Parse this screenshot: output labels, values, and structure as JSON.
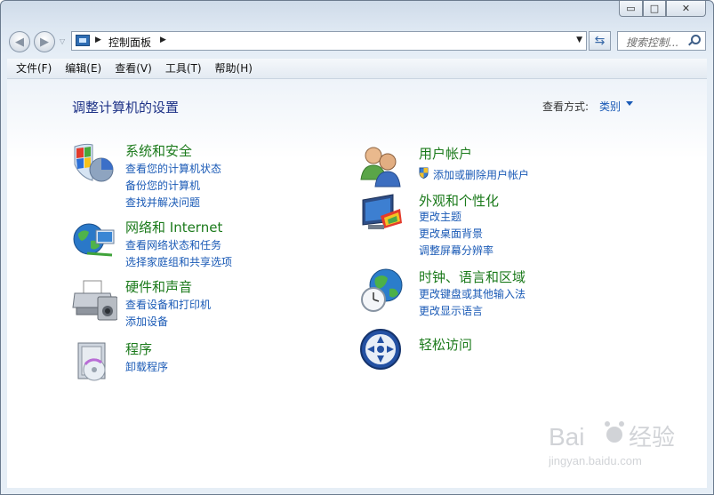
{
  "window": {
    "minimize": "▭",
    "maximize": "□",
    "close": "✕"
  },
  "address": {
    "breadcrumb": "控制面板",
    "search_placeholder": "搜索控制..."
  },
  "menu": [
    "文件(F)",
    "编辑(E)",
    "查看(V)",
    "工具(T)",
    "帮助(H)"
  ],
  "page": {
    "title": "调整计算机的设置",
    "view_by_label": "查看方式:",
    "view_by_value": "类别"
  },
  "categories": [
    {
      "title": "系统和安全",
      "links": [
        "查看您的计算机状态",
        "备份您的计算机",
        "查找并解决问题"
      ],
      "icon": "system-security-icon"
    },
    {
      "title": "网络和 Internet",
      "links": [
        "查看网络状态和任务",
        "选择家庭组和共享选项"
      ],
      "icon": "network-globe-icon"
    },
    {
      "title": "硬件和声音",
      "links": [
        "查看设备和打印机",
        "添加设备"
      ],
      "icon": "printer-icon"
    },
    {
      "title": "程序",
      "links": [
        "卸载程序"
      ],
      "icon": "programs-disc-icon"
    },
    {
      "title": "用户帐户",
      "links": [
        "添加或删除用户帐户"
      ],
      "icon": "user-accounts-icon"
    },
    {
      "title": "外观和个性化",
      "links": [
        "更改主题",
        "更改桌面背景",
        "调整屏幕分辨率"
      ],
      "icon": "monitor-palette-icon"
    },
    {
      "title": "时钟、语言和区域",
      "links": [
        "更改键盘或其他输入法",
        "更改显示语言"
      ],
      "icon": "clock-globe-icon"
    },
    {
      "title": "轻松访问",
      "links": [],
      "icon": "ease-of-access-icon"
    }
  ],
  "watermark": {
    "brand": "Bai",
    "brand2": "经验",
    "url": "jingyan.baidu.com"
  }
}
